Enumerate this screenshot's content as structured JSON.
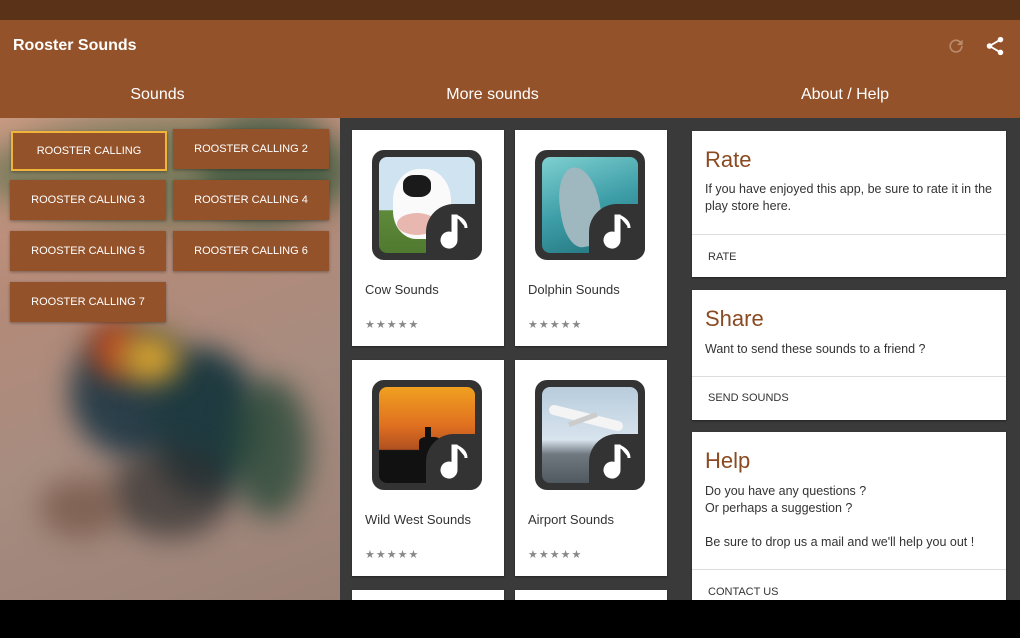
{
  "app": {
    "title": "Rooster Sounds"
  },
  "tabs": [
    {
      "label": "Sounds"
    },
    {
      "label": "More sounds"
    },
    {
      "label": "About / Help"
    }
  ],
  "sounds": [
    {
      "label": "ROOSTER CALLING",
      "active": true
    },
    {
      "label": "ROOSTER CALLING 2"
    },
    {
      "label": "ROOSTER CALLING 3"
    },
    {
      "label": "ROOSTER CALLING 4"
    },
    {
      "label": "ROOSTER CALLING 5"
    },
    {
      "label": "ROOSTER CALLING 6"
    },
    {
      "label": "ROOSTER CALLING 7"
    }
  ],
  "more_sounds": [
    {
      "label": "Cow Sounds",
      "rating": "★★★★★"
    },
    {
      "label": "Dolphin Sounds",
      "rating": "★★★★★"
    },
    {
      "label": "Wild West Sounds",
      "rating": "★★★★★"
    },
    {
      "label": "Airport Sounds",
      "rating": "★★★★★"
    }
  ],
  "about": {
    "rate": {
      "title": "Rate",
      "body": "If you have enjoyed this app, be sure to rate it in the play store here.",
      "action": "RATE"
    },
    "share": {
      "title": "Share",
      "body": "Want to send these sounds to a friend ?",
      "action": "SEND SOUNDS"
    },
    "help": {
      "title": "Help",
      "body_line1": "Do you have any questions ?",
      "body_line2": "Or perhaps a suggestion ?",
      "body_line3": "Be sure to drop us a mail and we'll help you out !",
      "action": "CONTACT US"
    }
  },
  "colors": {
    "primary": "#94522a",
    "status_bar": "#5a3218",
    "accent_border": "#f0b43a",
    "panel_bg": "#3a3a3a",
    "title_text": "#8a4a22"
  },
  "icons": {
    "refresh": "refresh-icon",
    "share": "share-icon",
    "music_note": "music-note-icon"
  }
}
